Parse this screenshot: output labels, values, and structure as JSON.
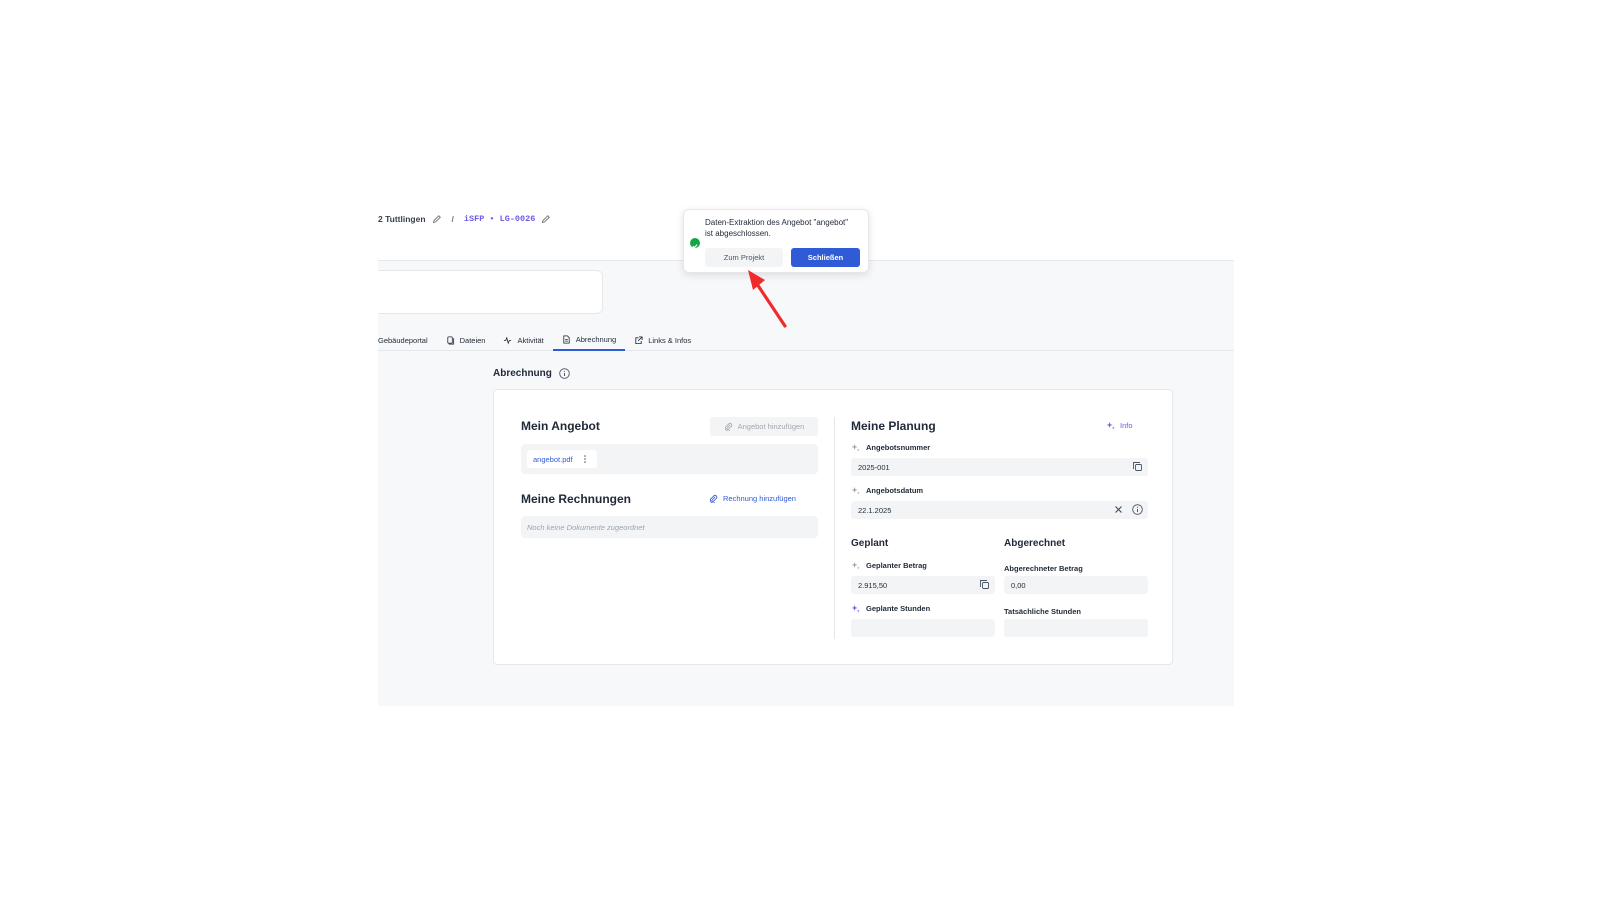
{
  "breadcrumb": {
    "project": "2 Tuttlingen",
    "separator": "/",
    "code": "iSFP • LG-0026"
  },
  "tabs": [
    {
      "label": "Gebäudeportal",
      "icon": "none"
    },
    {
      "label": "Dateien",
      "icon": "files-icon"
    },
    {
      "label": "Aktivität",
      "icon": "activity-icon"
    },
    {
      "label": "Abrechnung",
      "icon": "document-icon",
      "active": true
    },
    {
      "label": "Links & Infos",
      "icon": "external-link-icon"
    }
  ],
  "section": {
    "title": "Abrechnung"
  },
  "offer": {
    "title": "Mein Angebot",
    "add_label": "Angebot hinzufügen",
    "file_name": "angebot.pdf"
  },
  "invoices": {
    "title": "Meine Rechnungen",
    "add_label": "Rechnung hinzufügen",
    "empty_text": "Noch keine Dokumente zugeordnet"
  },
  "planning": {
    "title": "Meine Planung",
    "info_label": "Info",
    "offer_number_label": "Angebotsnummer",
    "offer_number_value": "2025-001",
    "offer_date_label": "Angebotsdatum",
    "offer_date_value": "22.1.2025",
    "planned_heading": "Geplant",
    "billed_heading": "Abgerechnet",
    "planned_amount_label": "Geplanter Betrag",
    "planned_amount_value": "2.915,50",
    "billed_amount_label": "Abgerechneter Betrag",
    "billed_amount_value": "0,00",
    "planned_hours_label": "Geplante Stunden",
    "planned_hours_value": "",
    "actual_hours_label": "Tatsächliche Stunden",
    "actual_hours_value": ""
  },
  "toast": {
    "message": "Daten-Extraktion des Angebot \"angebot\" ist abgeschlossen.",
    "secondary_label": "Zum Projekt",
    "primary_label": "Schließen"
  },
  "colors": {
    "primary": "#2f5bd6",
    "accent": "#6b5ce7",
    "success": "#16a34a",
    "annotation_arrow": "#ef2b2b"
  }
}
